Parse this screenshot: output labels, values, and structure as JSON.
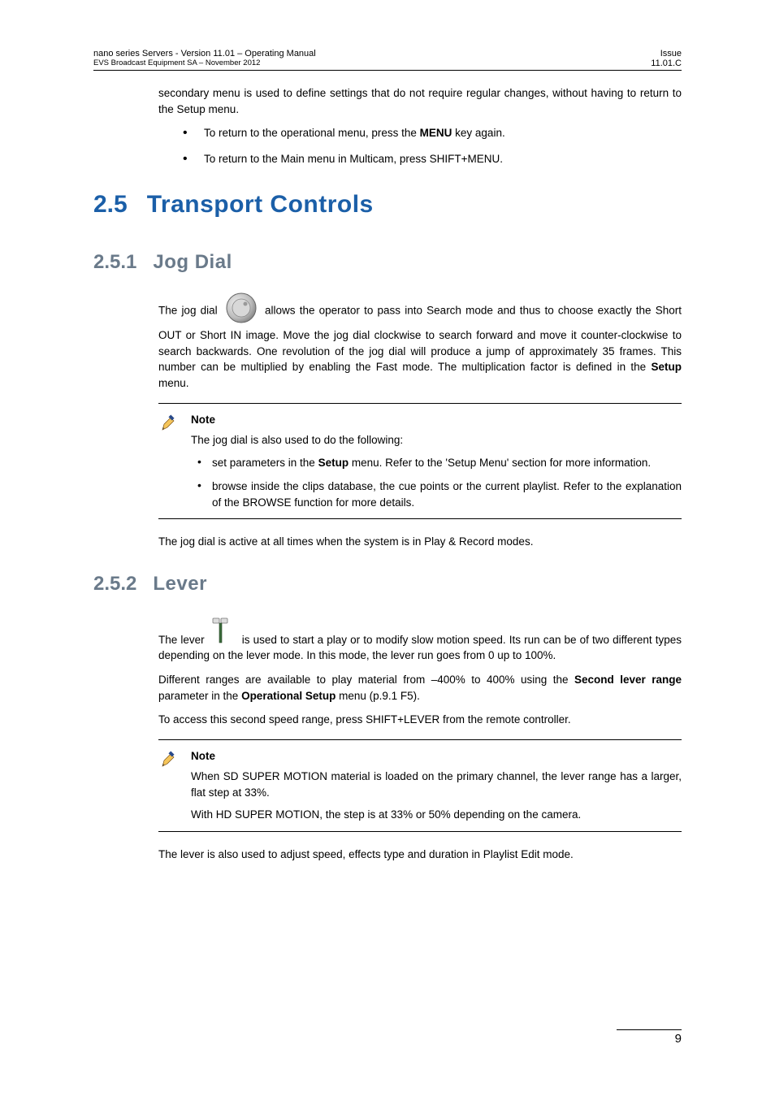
{
  "header": {
    "left_line1": "nano series Servers - Version 11.01 – Operating Manual",
    "left_line2": "EVS Broadcast Equipment SA – November 2012",
    "right_line1": "Issue",
    "right_line2": "11.01.C"
  },
  "intro": {
    "para": "secondary menu is used to define settings that do not require regular changes, without having to return to the Setup menu.",
    "bullet1_pre": "To return to the operational menu, press the ",
    "bullet1_bold": "MENU",
    "bullet1_post": " key again.",
    "bullet2": "To return to the Main menu in Multicam, press SHIFT+MENU."
  },
  "h1": {
    "num": "2.5",
    "title": "Transport Controls"
  },
  "jog": {
    "num": "2.5.1",
    "title": "Jog Dial",
    "pre": "The jog dial ",
    "post_pre": " allows the operator to pass into Search mode and thus to choose exactly the Short OUT or Short IN image. Move the jog dial clockwise to search forward and move it counter-clockwise to search backwards. One revolution of the jog dial will produce a jump of approximately 35 frames. This number can be multiplied by enabling the Fast mode. The multiplication factor is defined in the ",
    "bold_setup": "Setup",
    "post_post": " menu.",
    "note_title": "Note",
    "note_intro": "The jog dial is also used to do the following:",
    "note_b1_pre": "set parameters in the ",
    "note_b1_bold": "Setup",
    "note_b1_post": " menu. Refer to the 'Setup Menu' section for more information.",
    "note_b2": "browse inside the clips database, the cue points or the current playlist. Refer to the explanation of the BROWSE function for more details.",
    "after_note": "The jog dial is active at all times when the system is in Play & Record modes."
  },
  "lever": {
    "num": "2.5.2",
    "title": "Lever",
    "pre": "The lever ",
    "post": " is used to start a play or to modify slow motion speed. Its run can be of two different types depending on the lever mode. In this mode, the lever run goes from 0 up to 100%.",
    "para2_pre": "Different ranges are available to play material from –400% to 400% using the ",
    "para2_b1": "Second lever range",
    "para2_mid": " parameter in the ",
    "para2_b2": "Operational Setup",
    "para2_post": " menu (p.9.1 F5).",
    "para3": "To access this second speed range, press SHIFT+LEVER from the remote controller.",
    "note_title": "Note",
    "note_p1": "When SD SUPER MOTION material is loaded on the primary channel, the lever range has a larger, flat step at 33%.",
    "note_p2": "With HD SUPER MOTION, the step is at 33% or 50% depending on the camera.",
    "after_note": "The lever is also used to adjust speed, effects type and duration in Playlist Edit mode."
  },
  "page_number": "9"
}
